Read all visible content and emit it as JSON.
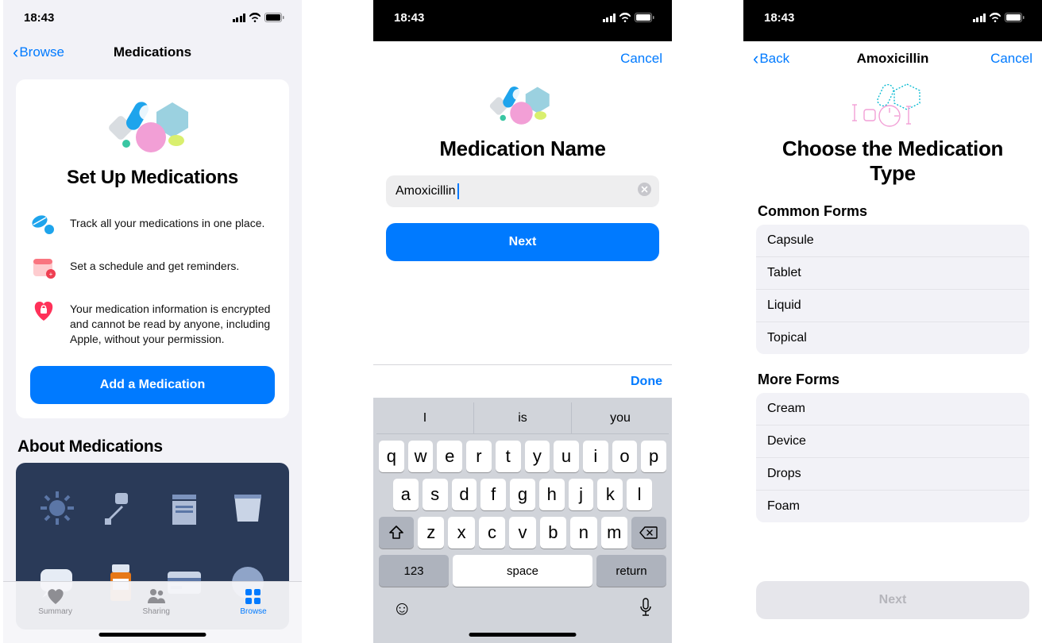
{
  "status": {
    "time": "18:43"
  },
  "screen1": {
    "nav_back": "Browse",
    "nav_title": "Medications",
    "card_title": "Set Up Medications",
    "feat1": "Track all your medications in one place.",
    "feat2": "Set a schedule and get reminders.",
    "feat3": "Your medication information is encrypted and cannot be read by anyone, including Apple, without your permission.",
    "add_button": "Add a Medication",
    "about_heading": "About Medications",
    "tabs": {
      "summary": "Summary",
      "sharing": "Sharing",
      "browse": "Browse"
    }
  },
  "screen2": {
    "cancel": "Cancel",
    "title": "Medication Name",
    "input_value": "Amoxicillin",
    "next": "Next",
    "done": "Done",
    "sugg": [
      "I",
      "is",
      "you"
    ],
    "rows": {
      "r1": [
        "q",
        "w",
        "e",
        "r",
        "t",
        "y",
        "u",
        "i",
        "o",
        "p"
      ],
      "r2": [
        "a",
        "s",
        "d",
        "f",
        "g",
        "h",
        "j",
        "k",
        "l"
      ],
      "r3": [
        "z",
        "x",
        "c",
        "v",
        "b",
        "n",
        "m"
      ],
      "num": "123",
      "space": "space",
      "ret": "return"
    }
  },
  "screen3": {
    "back": "Back",
    "title_nav": "Amoxicillin",
    "cancel": "Cancel",
    "title": "Choose the Medication Type",
    "common_h": "Common Forms",
    "common": [
      "Capsule",
      "Tablet",
      "Liquid",
      "Topical"
    ],
    "more_h": "More Forms",
    "more": [
      "Cream",
      "Device",
      "Drops",
      "Foam"
    ],
    "next": "Next"
  }
}
